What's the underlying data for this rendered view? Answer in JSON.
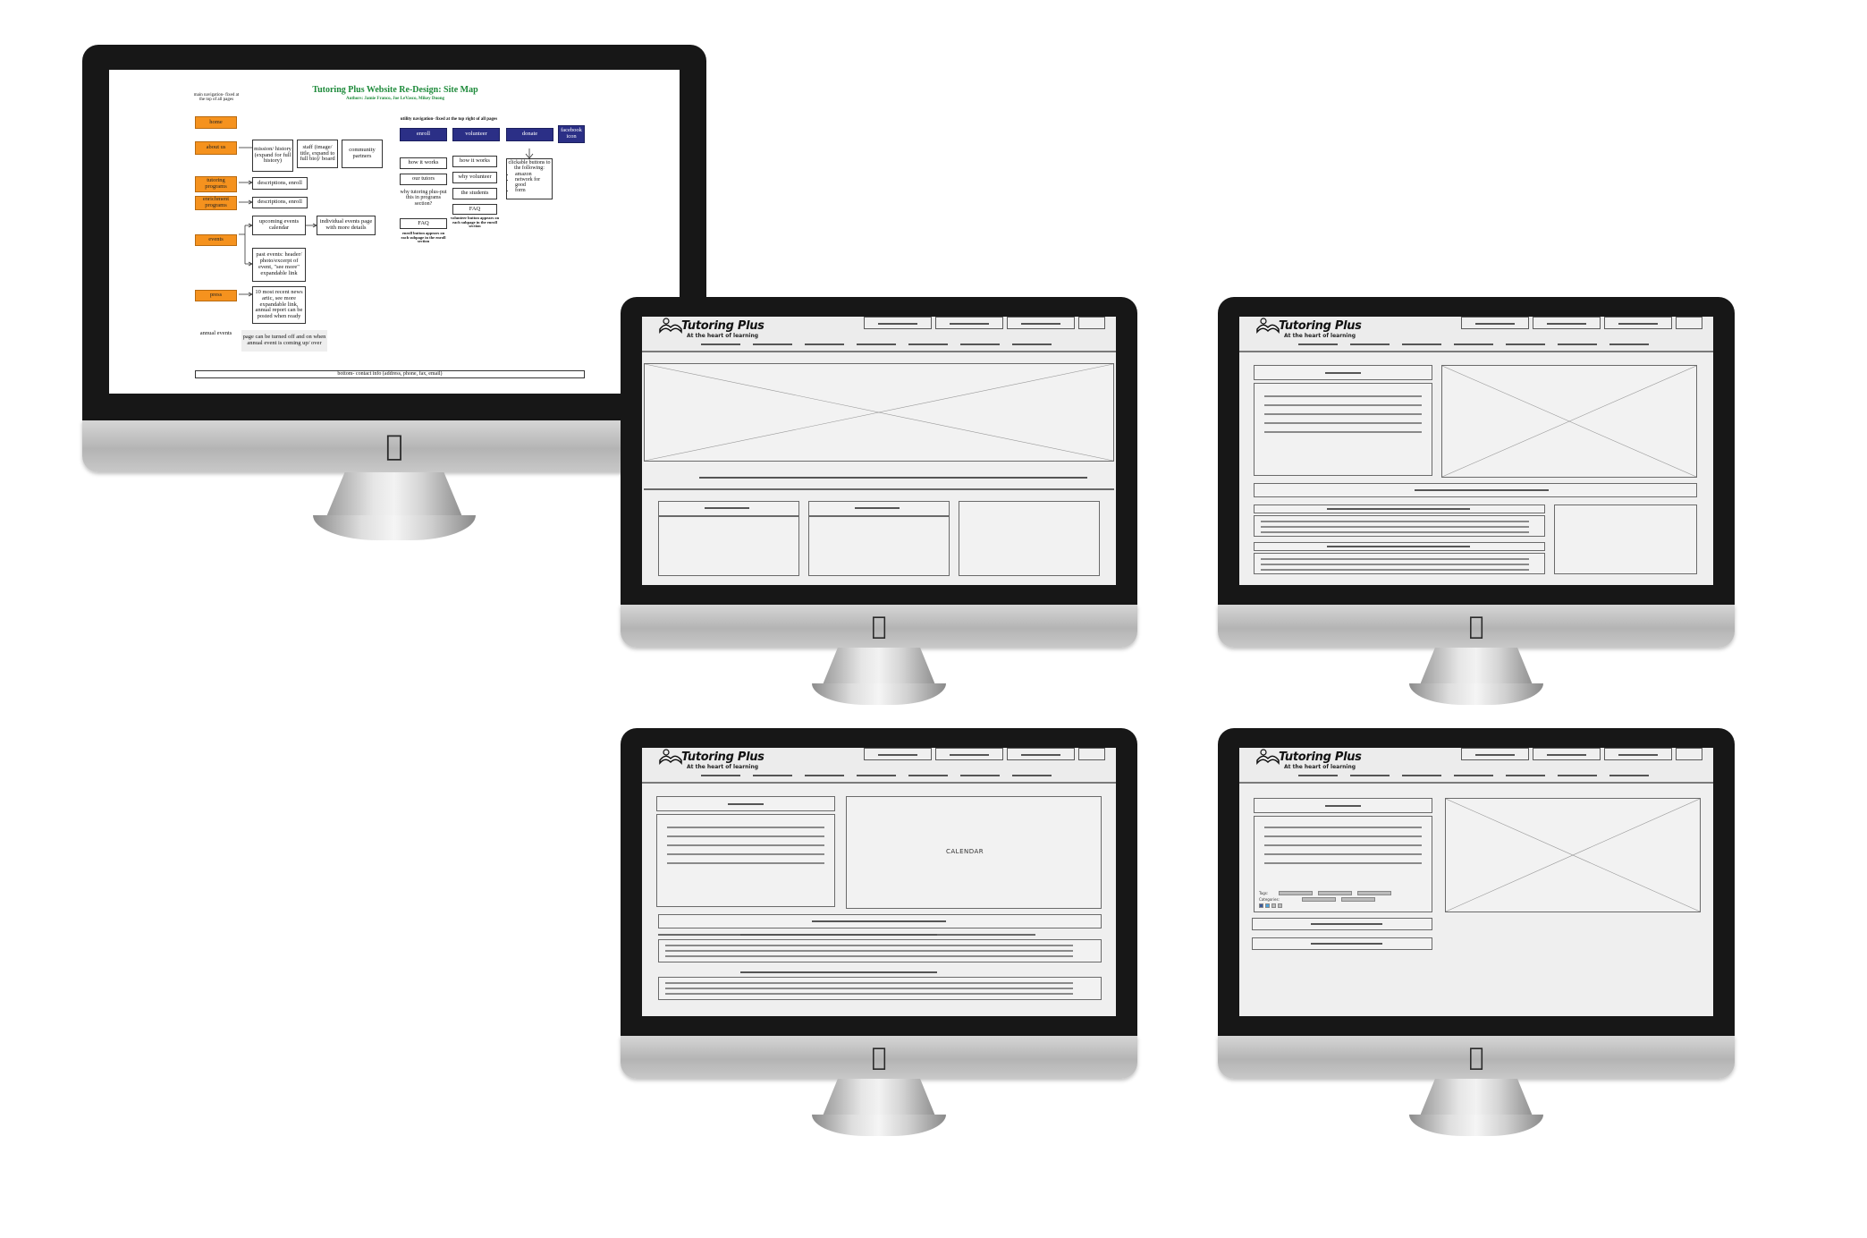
{
  "sitemap": {
    "title": "Tutoring Plus Website Re-Design: Site Map",
    "authors": "Authors: Jamie Franco, Joe LeVasco, Mikey Duong",
    "main_nav_note": "main navigation- fixed at the top of all pages",
    "utility_nav_note": "utility navigation- fixed at the top right of all pages",
    "main_nav": [
      "home",
      "about us",
      "tutoring programs",
      "enrichment programs",
      "events",
      "press"
    ],
    "about_children": [
      "mission/ history (expand for full history)",
      "staff (image/ title, expand to full bio)/ board",
      "community partners"
    ],
    "tutoring_child": "descriptions, enroll",
    "enrichment_child": "descriptions, enroll",
    "events_children": [
      "upcoming events calendar",
      "individual events page with more details",
      "past events: header/ photo/excerpt of event, \"see more\" expandable link"
    ],
    "press_child": "10 most recent news artic, see more expandable link, annual report can be posted when ready",
    "annual_events": "annual events",
    "annual_note": "page can be turned off and on when annual event is coming up/ over",
    "utility": {
      "enroll": "enroll",
      "volunteer": "volunteer",
      "donate": "donate",
      "facebook": "facebook icon"
    },
    "enroll_children": [
      "how it works",
      "our tutors",
      "why tutoring plus-put this in programs section?",
      "FAQ"
    ],
    "enroll_note": "enroll button appears on each subpage in the enroll section",
    "volunteer_children": [
      "how it works",
      "why volunteer",
      "the students",
      "FAQ"
    ],
    "volunteer_note": "volunteer button appears on each subpage in the enroll section",
    "donate_child_title": "clickable buttons to the following:",
    "donate_child_items": [
      "amazon",
      "network for good",
      "form"
    ],
    "footer": "bottom- contact info (address, phone, fax, email)"
  },
  "wireframe": {
    "logo": "Tutoring Plus",
    "tagline": "At the heart of learning",
    "calendar_label": "CALENDAR",
    "tags_label": "Tags:",
    "categories_label": "Categories:",
    "chip_text": "Lorem ips"
  },
  "colors": {
    "orange": "#f5921e",
    "navy": "#2b2f86",
    "title_green": "#1d8a3a",
    "bezel": "#171717"
  }
}
